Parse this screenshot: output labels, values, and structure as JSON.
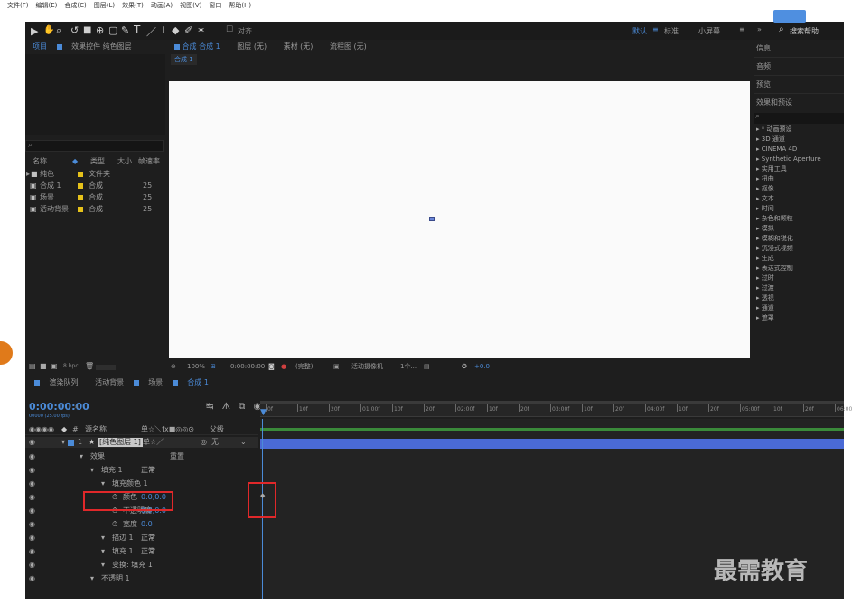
{
  "menubar": [
    "文件(F)",
    "编辑(E)",
    "合成(C)",
    "图层(L)",
    "效果(T)",
    "动画(A)",
    "视图(V)",
    "窗口",
    "帮助(H)"
  ],
  "toolbar": {
    "workspace_items": [
      "默认",
      "标准",
      "小屏幕"
    ],
    "search_help_label": "搜索帮助",
    "align_label": "对齐"
  },
  "project": {
    "tabs": [
      "项目",
      "效果控件 纯色图层"
    ],
    "search_placeholder": "",
    "columns": [
      "名称",
      "类型",
      "大小",
      "帧速率"
    ],
    "items": [
      {
        "name": "纯色",
        "type": "文件夹",
        "size": "",
        "fps": "",
        "color": "#e6c21a",
        "icon": "folder-icon"
      },
      {
        "name": "合成 1",
        "type": "合成",
        "size": "",
        "fps": "25",
        "color": "#e6c21a",
        "icon": "composition-icon"
      },
      {
        "name": "场景",
        "type": "合成",
        "size": "",
        "fps": "25",
        "color": "#e6c21a",
        "icon": "composition-icon"
      },
      {
        "name": "活动背景",
        "type": "合成",
        "size": "",
        "fps": "25",
        "color": "#e6c21a",
        "icon": "composition-icon"
      }
    ],
    "bottom_bpc": "8 bpc"
  },
  "viewer_tabs": {
    "items": [
      "合成 合成 1",
      "图层 (无)",
      "素材 (无)",
      "流程图 (无)"
    ],
    "breadcrumb": "合成 1"
  },
  "viewer_bar": {
    "zoom": "100%",
    "timecode": "0:00:00:00",
    "quality": "(完整)",
    "camera": "活动摄像机",
    "views": "1个...",
    "exposure": "+0.0"
  },
  "right_panel": {
    "tabs": [
      "信息",
      "音频",
      "预览",
      "效果和预设"
    ],
    "search_placeholder": "",
    "items": [
      "* 动画预设",
      "3D 通道",
      "CINEMA 4D",
      "Synthetic Aperture",
      "实用工具",
      "扭曲",
      "抠像",
      "文本",
      "时间",
      "杂色和颗粒",
      "模拟",
      "模糊和锐化",
      "沉浸式视频",
      "生成",
      "表达式控制",
      "过时",
      "过渡",
      "透视",
      "通道",
      "遮罩"
    ]
  },
  "timeline": {
    "tabs": [
      "渲染队列",
      "活动背景",
      "场景",
      "合成 1"
    ],
    "timecode": "0:00:00:00",
    "timecode_sub": "00000 (25.00 fps)",
    "search_placeholder": "",
    "columns": [
      "#",
      "源名称",
      "单☆＼fx■◎◎⊙",
      "父级"
    ],
    "layer": {
      "index": "1",
      "name": "[纯色图层 1]",
      "parent": "无"
    },
    "rows": [
      {
        "indent": 1,
        "label": "效果",
        "value": "",
        "extra": "重置"
      },
      {
        "indent": 2,
        "label": "填充 1",
        "value": "正常",
        "extra": ""
      },
      {
        "indent": 3,
        "label": "填充颜色 1",
        "value": "",
        "extra": ""
      },
      {
        "indent": 4,
        "label": "颜色",
        "value": "0.0,0.0",
        "extra": ""
      },
      {
        "indent": 4,
        "label": "不透明度",
        "value": "0.0,0.0",
        "extra": ""
      },
      {
        "indent": 4,
        "label": "宽度",
        "value": "0.0",
        "extra": ""
      },
      {
        "indent": 3,
        "label": "描边 1",
        "value": "正常",
        "extra": ""
      },
      {
        "indent": 3,
        "label": "填充 1",
        "value": "正常",
        "extra": ""
      },
      {
        "indent": 3,
        "label": "变换: 填充 1",
        "value": "",
        "extra": ""
      },
      {
        "indent": 2,
        "label": "不透明 1",
        "value": "",
        "extra": ""
      }
    ],
    "ruler_labels": [
      "0f",
      "10f",
      "20f",
      "01:00f",
      "10f",
      "20f",
      "02:00f",
      "10f",
      "20f",
      "03:00f",
      "10f",
      "20f",
      "04:00f",
      "10f",
      "20f",
      "05:00f",
      "10f",
      "20f",
      "06:00f"
    ]
  },
  "watermark": "最需教育",
  "colors": {
    "accent": "#4b8bd8",
    "highlight_box": "#e0282a",
    "layer_bar": "#4a6ad6",
    "layer_bar_green": "#3a8a3a"
  }
}
